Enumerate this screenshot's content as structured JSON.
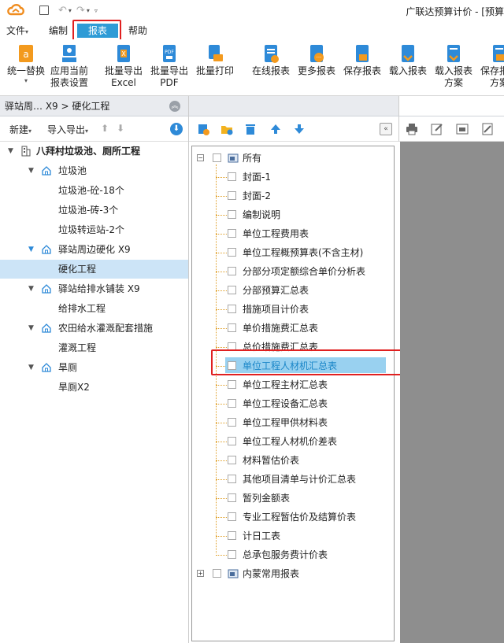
{
  "titlebar": {
    "title": "广联达预算计价 - [预算"
  },
  "menubar": {
    "file": "文件",
    "edit": "编制",
    "report": "报表",
    "help": "帮助"
  },
  "ribbon": [
    {
      "label1": "统一替换",
      "label2": "",
      "icon": "replace-icon"
    },
    {
      "label1": "应用当前",
      "label2": "报表设置",
      "icon": "apply-settings-icon"
    },
    {
      "label1": "批量导出",
      "label2": "Excel",
      "icon": "excel-export-icon"
    },
    {
      "label1": "批量导出",
      "label2": "PDF",
      "icon": "pdf-export-icon"
    },
    {
      "label1": "批量打印",
      "label2": "",
      "icon": "print-icon"
    },
    {
      "label1": "在线报表",
      "label2": "",
      "icon": "online-report-icon"
    },
    {
      "label1": "更多报表",
      "label2": "",
      "icon": "more-reports-icon"
    },
    {
      "label1": "保存报表",
      "label2": "",
      "icon": "save-report-icon"
    },
    {
      "label1": "载入报表",
      "label2": "",
      "icon": "load-report-icon"
    },
    {
      "label1": "载入报表",
      "label2": "方案",
      "icon": "load-scheme-icon"
    },
    {
      "label1": "保存报表",
      "label2": "方案",
      "icon": "save-scheme-icon"
    }
  ],
  "left": {
    "breadcrumb": "驿站周… X9 > 硬化工程",
    "new_label": "新建",
    "import_label": "导入导出",
    "tree": [
      {
        "text": "八拜村垃圾池、厕所工程",
        "level": 0,
        "bold": true,
        "expanded": true
      },
      {
        "text": "垃圾池",
        "level": 1,
        "expanded": true
      },
      {
        "text": "垃圾池-砼-18个",
        "level": 2
      },
      {
        "text": "垃圾池-砖-3个",
        "level": 2
      },
      {
        "text": "垃圾转运站-2个",
        "level": 2
      },
      {
        "text": "驿站周边硬化 X9",
        "level": 1,
        "expanded": true,
        "blue": true
      },
      {
        "text": "硬化工程",
        "level": 2,
        "selected": true
      },
      {
        "text": "驿站给排水铺装 X9",
        "level": 1,
        "expanded": true
      },
      {
        "text": "给排水工程",
        "level": 2
      },
      {
        "text": "农田给水灌溉配套措施",
        "level": 1,
        "expanded": true
      },
      {
        "text": "灌溉工程",
        "level": 2
      },
      {
        "text": "旱厕",
        "level": 1,
        "expanded": true
      },
      {
        "text": "旱厕X2",
        "level": 2
      }
    ]
  },
  "reports": {
    "root": "所有",
    "items": [
      "封面-1",
      "封面-2",
      "编制说明",
      "单位工程费用表",
      "单位工程概预算表(不含主材)",
      "分部分项定额综合单价分析表",
      "分部预算汇总表",
      "措施项目计价表",
      "单价措施费汇总表",
      "总价措施费汇总表",
      "单位工程人材机汇总表",
      "单位工程主材汇总表",
      "单位工程设备汇总表",
      "单位工程甲供材料表",
      "单位工程人材机价差表",
      "材料暂估价表",
      "其他项目清单与计价汇总表",
      "暂列金额表",
      "专业工程暂估价及结算价表",
      "计日工表",
      "总承包服务费计价表"
    ],
    "highlighted_index": 10,
    "second_root": "内蒙常用报表"
  }
}
